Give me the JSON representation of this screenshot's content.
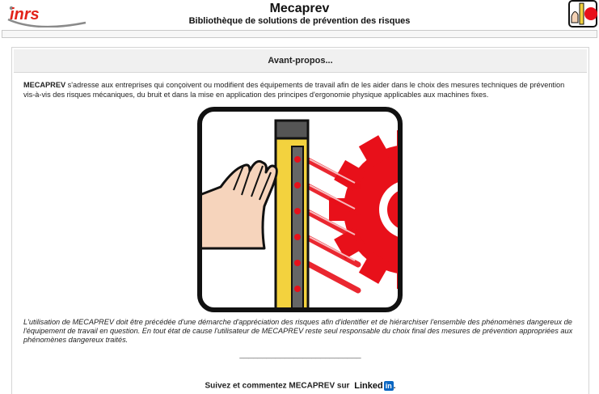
{
  "header": {
    "logo_text": "inrs",
    "title": "Mecaprev",
    "subtitle": "Bibliothèque de solutions de prévention des risques"
  },
  "main": {
    "section_title": "Avant-propos...",
    "intro_bold": "MECAPREV",
    "intro_text": " s'adresse aux entreprises qui conçoivent ou modifient des équipements de travail afin de les aider dans le choix des mesures techniques de prévention vis-à-vis des risques mécaniques, du bruit et dans la mise en application des principes d'ergonomie physique applicables aux machines fixes.",
    "disclaimer": "L'utilisation de MECAPREV doit être précédée d'une démarche d'appréciation des risques afin d'identifier et de hiérarchiser l'ensemble des phénomènes dangereux de l'équipement de travail en question. En tout état de cause l'utilisateur de MECAPREV reste seul responsable du choix final des mesures de prévention appropriées aux phénomènes dangereux traités.",
    "separator": "___________________________",
    "follow_text": "Suivez et commentez MECAPREV sur",
    "linkedin_word": "Linked",
    "linkedin_in": "in",
    "follow_suffix": "."
  },
  "colors": {
    "logo_red": "#e2231a",
    "logo_gray": "#8a8a8a",
    "gear_red": "#e8101a",
    "barrier_yellow": "#f3d23e",
    "linkedin_blue": "#0a66c2"
  },
  "icons": {
    "logo": "inrs-logo",
    "corner": "mecaprev-corner-icon",
    "pictogram": "light-curtain-pictogram",
    "linkedin": "linkedin-logo"
  }
}
